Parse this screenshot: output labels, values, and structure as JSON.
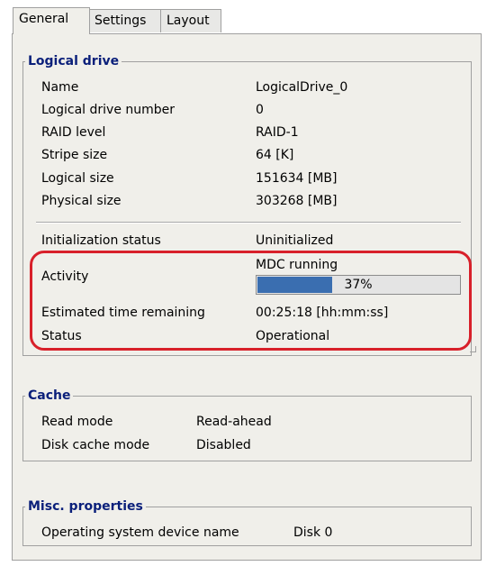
{
  "tabs": [
    {
      "label": "General",
      "active": true
    },
    {
      "label": "Settings",
      "active": false
    },
    {
      "label": "Layout",
      "active": false
    }
  ],
  "logical_drive": {
    "title": "Logical drive",
    "rows": [
      {
        "label": "Name",
        "value": "LogicalDrive_0"
      },
      {
        "label": "Logical drive number",
        "value": "0"
      },
      {
        "label": "RAID level",
        "value": "RAID-1"
      },
      {
        "label": "Stripe size",
        "value": "64 [K]"
      },
      {
        "label": "Logical size",
        "value": "151634 [MB]"
      },
      {
        "label": "Physical size",
        "value": "303268 [MB]"
      }
    ],
    "init_status": {
      "label": "Initialization status",
      "value": "Uninitialized"
    },
    "activity": {
      "label": "Activity",
      "value": "MDC running",
      "progress_text": "37%",
      "progress_fraction": 0.37
    },
    "time_remaining": {
      "label": "Estimated time remaining",
      "value": "00:25:18 [hh:mm:ss]"
    },
    "status": {
      "label": "Status",
      "value": "Operational"
    }
  },
  "cache": {
    "title": "Cache",
    "rows": [
      {
        "label": "Read mode",
        "value": "Read-ahead"
      },
      {
        "label": "Disk cache mode",
        "value": "Disabled"
      }
    ]
  },
  "misc": {
    "title": "Misc. properties",
    "rows": [
      {
        "label": "Operating system device name",
        "value": "Disk 0"
      }
    ]
  },
  "colors": {
    "group_title": "#0a1f7a",
    "highlight": "#d8202a",
    "progress_fill": "#3a6eb0",
    "panel_bg": "#f0efea"
  }
}
